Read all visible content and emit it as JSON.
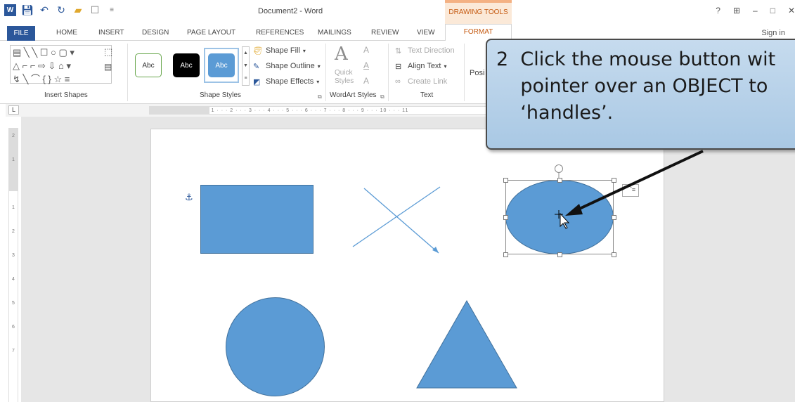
{
  "window": {
    "title": "Document2 - Word",
    "contextual_header": "DRAWING TOOLS",
    "sign_in": "Sign in",
    "controls": [
      "?",
      "⊞",
      "–",
      "□",
      "✕"
    ]
  },
  "tabs": [
    "FILE",
    "HOME",
    "INSERT",
    "DESIGN",
    "PAGE LAYOUT",
    "REFERENCES",
    "MAILINGS",
    "REVIEW",
    "VIEW",
    "FORMAT"
  ],
  "ribbon": {
    "insert_shapes": {
      "label": "Insert Shapes",
      "row1": "▤ ╲ ╲ ☐ ○ ▢ ▾",
      "row2": "△ ⌐ ⌐ ⇨ ⇩ ⌂ ▾",
      "row3": "↯ ╲ ⌒ { } ☆ ≡"
    },
    "shape_styles": {
      "label": "Shape Styles",
      "samples": [
        "Abc",
        "Abc",
        "Abc"
      ],
      "shape_fill": "Shape Fill",
      "shape_outline": "Shape Outline",
      "shape_effects": "Shape Effects"
    },
    "wordart_styles": {
      "label": "WordArt Styles",
      "big_a": "A",
      "quick_styles_line1": "Quick",
      "quick_styles_line2": "Styles",
      "small_a": "A"
    },
    "text": {
      "label": "Text",
      "text_direction": "Text Direction",
      "align_text": "Align Text",
      "create_link": "Create Link"
    },
    "arrange": {
      "position_truncated": "Posi"
    }
  },
  "ruler": {
    "corner": "L",
    "horizontal": "· 2 · · · 1 · · · ⌂ · · · 1 · · · 2 · · · 3 · · · 4 · · · 5 · · · 6 · · · 7 · · · 8 · · · 9 · · · 10 · · · 11",
    "vertical": [
      "2",
      "1",
      "",
      "1",
      "2",
      "3",
      "4",
      "5",
      "6",
      "7",
      "8"
    ]
  },
  "callout": {
    "text": "2  Click the mouse button wit\n    pointer over an OBJECT to\n    ‘handles’."
  }
}
